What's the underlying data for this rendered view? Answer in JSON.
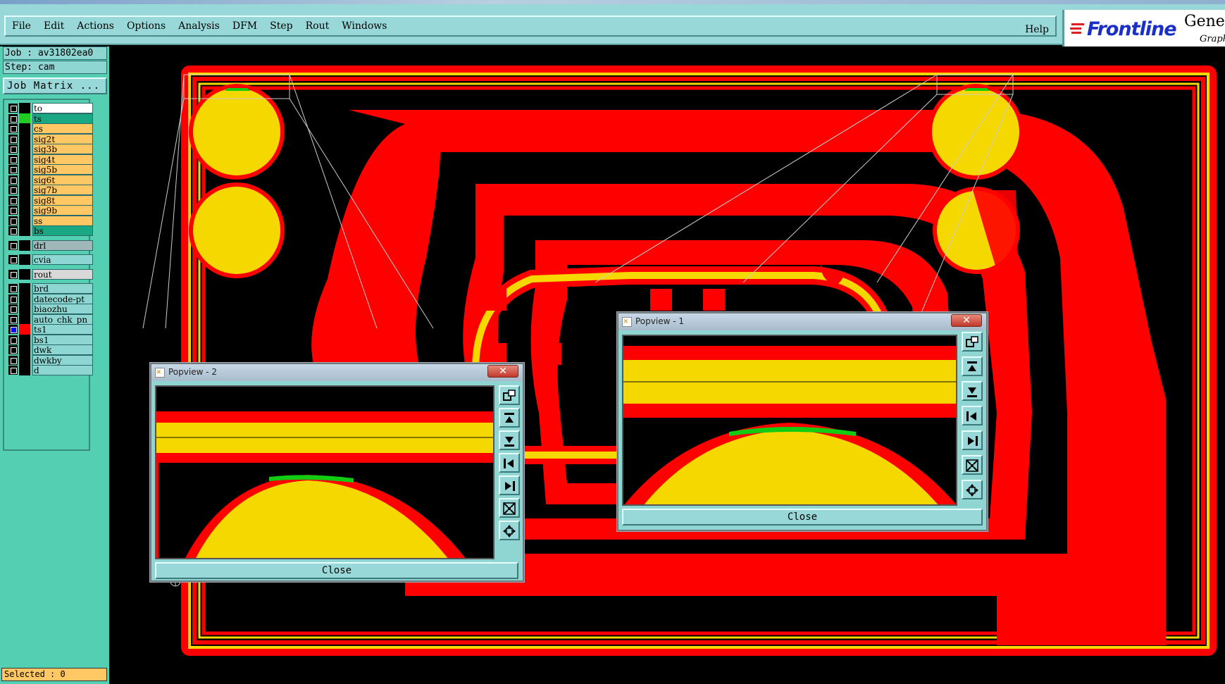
{
  "menubar": {
    "items": [
      {
        "label": "File"
      },
      {
        "label": "Edit"
      },
      {
        "label": "Actions"
      },
      {
        "label": "Options"
      },
      {
        "label": "Analysis"
      },
      {
        "label": "DFM"
      },
      {
        "label": "Step"
      },
      {
        "label": "Rout"
      },
      {
        "label": "Windows"
      }
    ],
    "help_label": "Help"
  },
  "logo": {
    "brand": "Frontline",
    "product": "Genes",
    "subtitle": "Graph"
  },
  "job": {
    "job_label": "Job : av31802ea0",
    "step_label": "Step: cam",
    "matrix_button": "Job Matrix ..."
  },
  "layers": [
    {
      "name": "to",
      "color": "#ffffff",
      "swatch": "#000000",
      "selected": false
    },
    {
      "name": "ts",
      "color": "#1aa882",
      "swatch": "#22cc22",
      "selected": false
    },
    {
      "name": "cs",
      "color": "#ffc864",
      "swatch": "#000000",
      "selected": false
    },
    {
      "name": "sig2t",
      "color": "#ffc864",
      "swatch": "#000000",
      "selected": false
    },
    {
      "name": "sig3b",
      "color": "#ffc864",
      "swatch": "#000000",
      "selected": false
    },
    {
      "name": "sig4t",
      "color": "#ffc864",
      "swatch": "#000000",
      "selected": false
    },
    {
      "name": "sig5b",
      "color": "#ffc864",
      "swatch": "#000000",
      "selected": false
    },
    {
      "name": "sig6t",
      "color": "#ffc864",
      "swatch": "#000000",
      "selected": false
    },
    {
      "name": "sig7b",
      "color": "#ffc864",
      "swatch": "#000000",
      "selected": false
    },
    {
      "name": "sig8t",
      "color": "#ffc864",
      "swatch": "#000000",
      "selected": false
    },
    {
      "name": "sig9b",
      "color": "#ffc864",
      "swatch": "#000000",
      "selected": false
    },
    {
      "name": "ss",
      "color": "#ffc864",
      "swatch": "#000000",
      "selected": false
    },
    {
      "name": "bs",
      "color": "#1aa882",
      "swatch": "#000000",
      "selected": false
    },
    {
      "name": "drl",
      "color": "#a0b8b8",
      "swatch": "#000000",
      "selected": false
    },
    {
      "name": "cvia",
      "color": "#8dd6d2",
      "swatch": "#000000",
      "selected": false
    },
    {
      "name": "rout",
      "color": "#d8d8d8",
      "swatch": "#000000",
      "selected": false
    },
    {
      "name": "brd",
      "color": "#8dd6d2",
      "swatch": "#000000",
      "selected": false
    },
    {
      "name": "datecode-pt",
      "color": "#8dd6d2",
      "swatch": "#000000",
      "selected": false
    },
    {
      "name": "biaozhu",
      "color": "#8dd6d2",
      "swatch": "#000000",
      "selected": false
    },
    {
      "name": "auto_chk_pn",
      "color": "#8dd6d2",
      "swatch": "#000000",
      "selected": false
    },
    {
      "name": "ts1",
      "color": "#8dd6d2",
      "swatch": "#ff0000",
      "selected": true
    },
    {
      "name": "bs1",
      "color": "#8dd6d2",
      "swatch": "#000000",
      "selected": false
    },
    {
      "name": "dwk",
      "color": "#8dd6d2",
      "swatch": "#000000",
      "selected": false
    },
    {
      "name": "dwkby",
      "color": "#8dd6d2",
      "swatch": "#000000",
      "selected": false
    },
    {
      "name": "d",
      "color": "#8dd6d2",
      "swatch": "#000000",
      "selected": false
    }
  ],
  "status": {
    "selected_label": "Selected : 0"
  },
  "popview1": {
    "title": "Popview - 1",
    "close_label": "Close"
  },
  "popview2": {
    "title": "Popview - 2",
    "close_label": "Close"
  },
  "colors": {
    "copper_red": "#ff0000",
    "pad_yellow": "#f5d800",
    "mask_green": "#11cc11",
    "menu_bg": "#99d8d8",
    "panel_bg": "#55cfb2"
  },
  "popview_tools": [
    {
      "icon": "zoom-window-icon"
    },
    {
      "icon": "pan-up-icon"
    },
    {
      "icon": "pan-down-icon"
    },
    {
      "icon": "pan-left-icon"
    },
    {
      "icon": "pan-right-icon"
    },
    {
      "icon": "zoom-in-icon"
    },
    {
      "icon": "zoom-out-icon"
    }
  ]
}
